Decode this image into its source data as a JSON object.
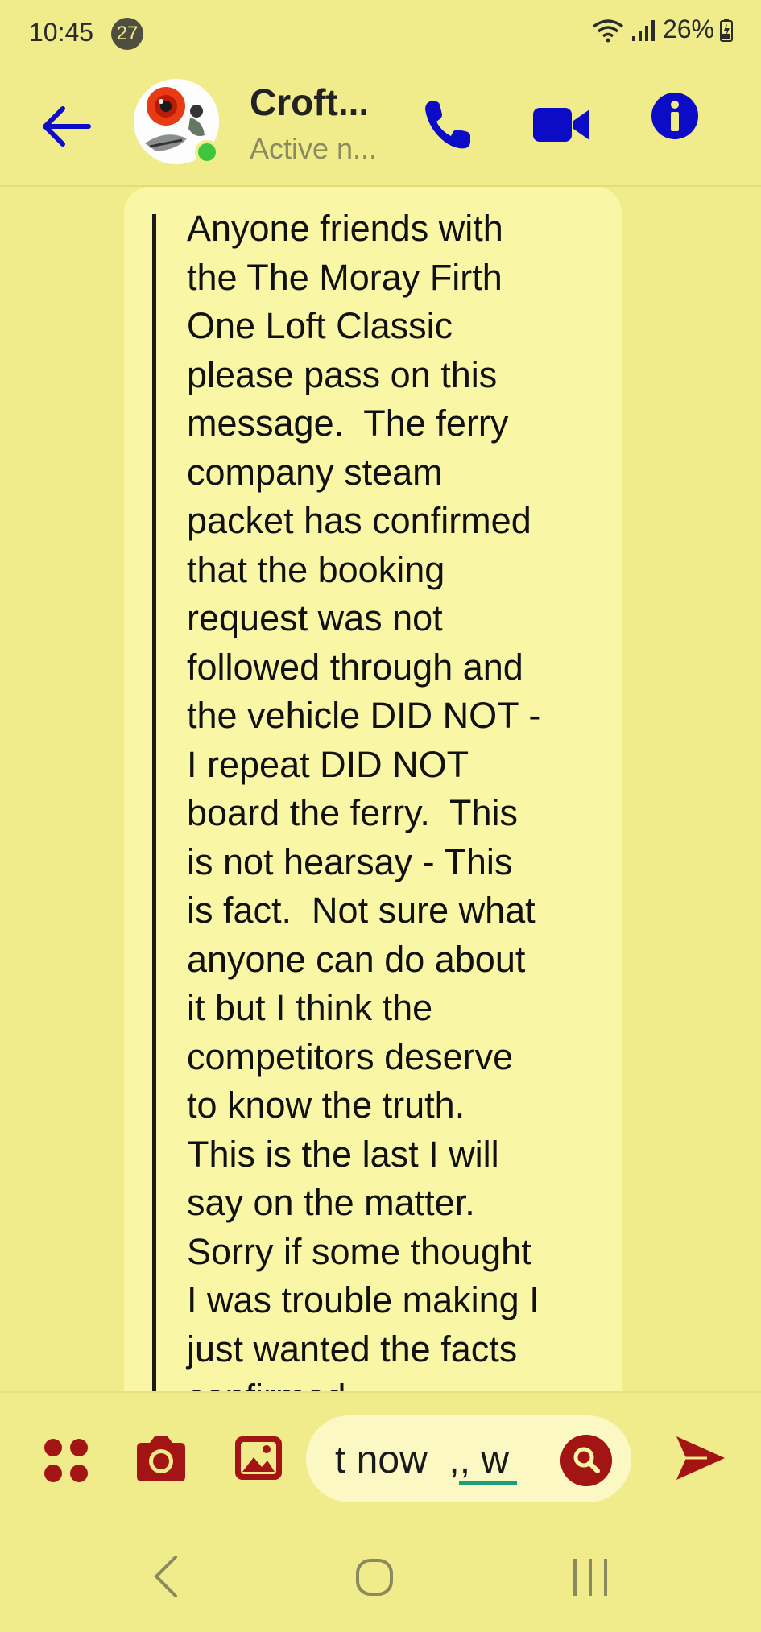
{
  "status_bar": {
    "time": "10:45",
    "notification_count": "27",
    "battery": "26%"
  },
  "header": {
    "contact_name": "Croft...",
    "contact_status": "Active n...",
    "accent_color": "#0c0cc7"
  },
  "message": {
    "text": "Anyone friends with\nthe The Moray Firth\nOne Loft Classic\nplease pass on this\nmessage.  The ferry\ncompany steam\npacket has confirmed\nthat the booking\nrequest was not\nfollowed through and\nthe vehicle DID NOT -\nI repeat DID NOT\nboard the ferry.  This\nis not hearsay - This\nis fact.  Not sure what\nanyone can do about\nit but I think the\ncompetitors deserve\nto know the truth.\nThis is the last I will\nsay on the matter.\nSorry if some thought\nI was trouble making I\njust wanted the facts\nconfirmed."
  },
  "composer": {
    "input_value": "t now  ,, w",
    "accent_color": "#a31515"
  },
  "icons": {
    "back": "arrow-left-icon",
    "call": "phone-icon",
    "video": "video-camera-icon",
    "info": "info-icon",
    "apps": "four-dots-icon",
    "camera": "camera-icon",
    "gallery": "image-icon",
    "search": "search-icon",
    "send": "send-icon"
  }
}
